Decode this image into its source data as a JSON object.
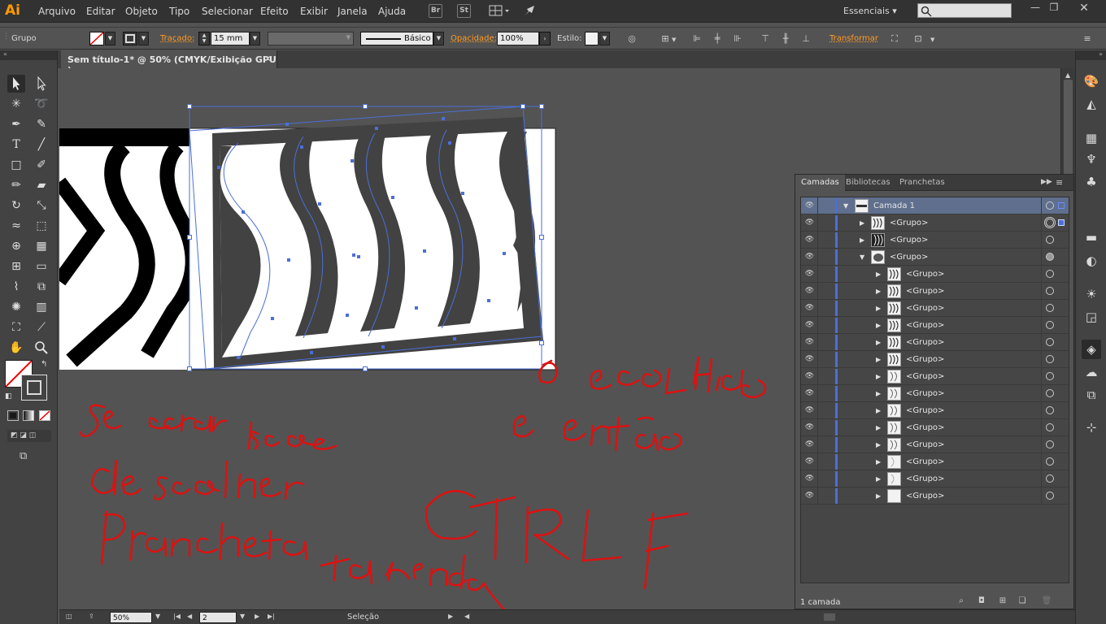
{
  "app": {
    "logo": "Ai"
  },
  "menu": [
    "Arquivo",
    "Editar",
    "Objeto",
    "Tipo",
    "Selecionar",
    "Efeito",
    "Exibir",
    "Janela",
    "Ajuda"
  ],
  "menubar_icons": {
    "br": "Br",
    "st": "St"
  },
  "workspace": "Essenciais",
  "control": {
    "object_type": "Grupo",
    "stroke_label": "Traçado:",
    "stroke_value": "15 mm",
    "brush_label": "Básico",
    "opacity_label": "Opacidade:",
    "opacity_value": "100%",
    "style_label": "Estilo:",
    "transform_label": "Transformar"
  },
  "document_tab": {
    "title": "Sem título-1* @ 50% (CMYK/Exibição GPU )",
    "close": "✕"
  },
  "status": {
    "zoom": "50%",
    "artboard": "2",
    "tool": "Seleção"
  },
  "layers_panel": {
    "tabs": [
      "Camadas",
      "Bibliotecas",
      "Pranchetas"
    ],
    "active_tab": "Camadas",
    "layer_count": "1 camada",
    "rows": [
      {
        "name": "Camada 1",
        "level": 0,
        "expanded": true,
        "thumb": "layer"
      },
      {
        "name": "<Grupo>",
        "level": 1,
        "expanded": false,
        "thumb": "wave"
      },
      {
        "name": "<Grupo>",
        "level": 1,
        "expanded": false,
        "thumb": "wave-dark"
      },
      {
        "name": "<Grupo>",
        "level": 1,
        "expanded": true,
        "thumb": "blob"
      },
      {
        "name": "<Grupo>",
        "level": 2,
        "expanded": false,
        "thumb": "wave"
      },
      {
        "name": "<Grupo>",
        "level": 2,
        "expanded": false,
        "thumb": "wave"
      },
      {
        "name": "<Grupo>",
        "level": 2,
        "expanded": false,
        "thumb": "wave"
      },
      {
        "name": "<Grupo>",
        "level": 2,
        "expanded": false,
        "thumb": "wave"
      },
      {
        "name": "<Grupo>",
        "level": 2,
        "expanded": false,
        "thumb": "wave"
      },
      {
        "name": "<Grupo>",
        "level": 2,
        "expanded": false,
        "thumb": "wave"
      },
      {
        "name": "<Grupo>",
        "level": 2,
        "expanded": false,
        "thumb": "wave-light"
      },
      {
        "name": "<Grupo>",
        "level": 2,
        "expanded": false,
        "thumb": "wave-light"
      },
      {
        "name": "<Grupo>",
        "level": 2,
        "expanded": false,
        "thumb": "wave-light"
      },
      {
        "name": "<Grupo>",
        "level": 2,
        "expanded": false,
        "thumb": "wave-light"
      },
      {
        "name": "<Grupo>",
        "level": 2,
        "expanded": false,
        "thumb": "wave-light"
      },
      {
        "name": "<Grupo>",
        "level": 2,
        "expanded": false,
        "thumb": "faint"
      },
      {
        "name": "<Grupo>",
        "level": 2,
        "expanded": false,
        "thumb": "faint"
      },
      {
        "name": "<Grupo>",
        "level": 2,
        "expanded": false,
        "thumb": "blank"
      }
    ]
  },
  "annotation": {
    "text_left": [
      "Se errar isso",
      "de escolher",
      "Prancheta da merda"
    ],
    "text_right": [
      "O escolhido",
      "e então",
      "CTRL F"
    ]
  },
  "colors": {
    "accent_orange": "#ff9a00",
    "selection_blue": "#4b6fd8",
    "annotation_red": "#dd1111",
    "panel_bg": "#535353"
  }
}
